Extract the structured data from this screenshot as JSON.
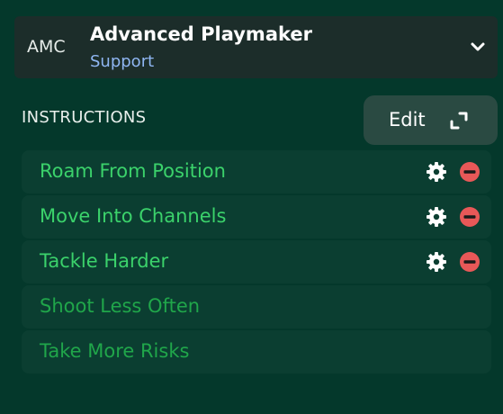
{
  "role": {
    "position": "AMC",
    "name": "Advanced Playmaker",
    "duty": "Support",
    "chevron_icon": "chevron-down-icon"
  },
  "instructions": {
    "title": "INSTRUCTIONS",
    "edit_label": "Edit",
    "edit_icon": "expand-icon",
    "colors": {
      "active_text": "#3bd26b",
      "inactive_text": "#20a64a",
      "remove": "#e85858"
    },
    "items": [
      {
        "label": "Roam From Position",
        "active": true
      },
      {
        "label": "Move Into Channels",
        "active": true
      },
      {
        "label": "Tackle Harder",
        "active": true
      },
      {
        "label": "Shoot Less Often",
        "active": false
      },
      {
        "label": "Take More Risks",
        "active": false
      }
    ]
  }
}
